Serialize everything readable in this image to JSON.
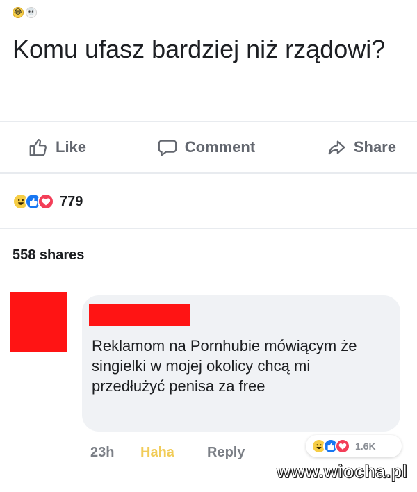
{
  "post": {
    "header_emojis": [
      {
        "name": "laughing-emoji",
        "glyph": "😂"
      },
      {
        "name": "skull-emoji",
        "glyph": "💀"
      }
    ],
    "title": "Komu ufasz bardziej niż rządowi?"
  },
  "actions": {
    "like_label": "Like",
    "comment_label": "Comment",
    "share_label": "Share"
  },
  "post_reactions": {
    "icons": [
      "haha",
      "like",
      "love"
    ],
    "count": "779"
  },
  "shares": "558 shares",
  "comment": {
    "text": "Reklamom na Pornhubie mówiącym że singielki w mojej okolicy chcą mi przedłużyć penisa za free",
    "time": "23h",
    "reaction_action": "Haha",
    "reply_label": "Reply",
    "reactions": {
      "icons": [
        "haha",
        "like",
        "love"
      ],
      "count": "1.6K"
    }
  },
  "watermark": "www.wiocha.pl",
  "colors": {
    "redaction": "#ff1414",
    "like": "#1877f2",
    "love": "#f33e58",
    "haha": "#f6cd45",
    "muted_text": "#63676f"
  }
}
